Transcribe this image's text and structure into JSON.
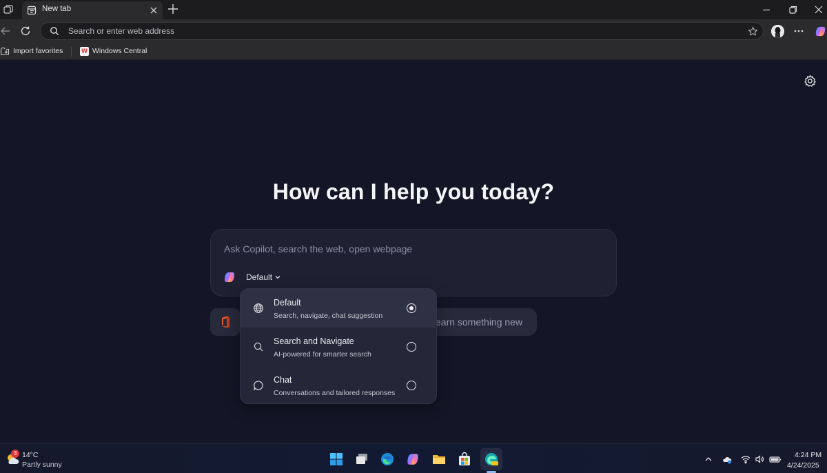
{
  "tab": {
    "title": "New tab"
  },
  "addressbar": {
    "placeholder": "Search or enter web address"
  },
  "favorites": [
    {
      "label": "Import favorites",
      "icon": "import-icon"
    },
    {
      "label": "Windows Central",
      "icon": "windows-central-icon"
    }
  ],
  "favorites_wc_glyph": "W",
  "page": {
    "headline": "How can I help you today?",
    "search_placeholder": "Ask Copilot, search the web, open webpage",
    "mode_label": "Default",
    "chip_text": "earn something new"
  },
  "mode_menu": {
    "items": [
      {
        "title": "Default",
        "desc": "Search, navigate, chat suggestion",
        "icon": "globe-icon",
        "selected": true
      },
      {
        "title": "Search and Navigate",
        "desc": "AI-powered for smarter search",
        "icon": "search-icon",
        "selected": false
      },
      {
        "title": "Chat",
        "desc": "Conversations and tailored responses",
        "icon": "chat-bubble-icon",
        "selected": false
      }
    ]
  },
  "taskbar": {
    "weather_temp": "14°C",
    "weather_desc": "Partly sunny",
    "weather_badge": "3",
    "apps": [
      "start-icon",
      "task-view-icon",
      "edge-icon",
      "copilot-icon",
      "file-explorer-icon",
      "store-icon",
      "edge-canary-icon"
    ],
    "time": "4:24 PM",
    "date": "4/24/2025"
  },
  "colors": {
    "page_bg": "#141627",
    "card_bg": "#1f2133",
    "menu_bg": "#252738",
    "selected_row": "#2e3043"
  }
}
